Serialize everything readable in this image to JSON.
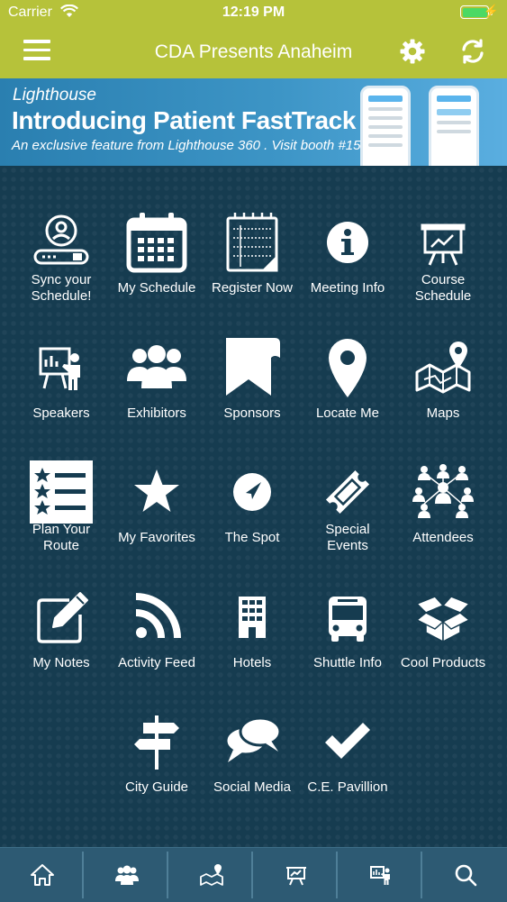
{
  "status_bar": {
    "carrier": "Carrier",
    "time": "12:19 PM",
    "battery_color": "#4cd964"
  },
  "navbar": {
    "title": "CDA Presents Anaheim",
    "background": "#b6c23a",
    "left_icon": "hamburger-menu-icon",
    "right_icons": [
      "gear-icon",
      "refresh-icon"
    ]
  },
  "banner": {
    "brand": "Lighthouse",
    "headline": "Introducing Patient FastTrack",
    "subtext": "An exclusive feature from Lighthouse 360 . Visit booth #1534"
  },
  "grid": {
    "tiles": [
      {
        "label": "Sync your\nSchedule!",
        "icon": "sync-schedule-icon"
      },
      {
        "label": "My Schedule",
        "icon": "calendar-icon"
      },
      {
        "label": "Register Now",
        "icon": "notepad-icon"
      },
      {
        "label": "Meeting Info",
        "icon": "info-icon"
      },
      {
        "label": "Course\nSchedule",
        "icon": "presentation-board-icon"
      },
      {
        "label": "Speakers",
        "icon": "speaker-icon"
      },
      {
        "label": "Exhibitors",
        "icon": "people-group-icon"
      },
      {
        "label": "Sponsors",
        "icon": "bookmark-ribbon-icon"
      },
      {
        "label": "Locate Me",
        "icon": "map-pin-icon"
      },
      {
        "label": "Maps",
        "icon": "folded-map-icon"
      },
      {
        "label": "Plan Your\nRoute",
        "icon": "star-list-icon"
      },
      {
        "label": "My Favorites",
        "icon": "star-icon"
      },
      {
        "label": "The Spot",
        "icon": "navigation-arrow-icon"
      },
      {
        "label": "Special\nEvents",
        "icon": "ticket-icon"
      },
      {
        "label": "Attendees",
        "icon": "network-people-icon"
      },
      {
        "label": "My Notes",
        "icon": "edit-note-icon"
      },
      {
        "label": "Activity Feed",
        "icon": "rss-icon"
      },
      {
        "label": "Hotels",
        "icon": "building-icon"
      },
      {
        "label": "Shuttle Info",
        "icon": "bus-icon"
      },
      {
        "label": "Cool Products",
        "icon": "open-box-icon"
      },
      {
        "label": "City Guide",
        "icon": "signpost-icon"
      },
      {
        "label": "Social Media",
        "icon": "chat-bubbles-icon"
      },
      {
        "label": "C.E. Pavillion",
        "icon": "checkmark-icon"
      }
    ]
  },
  "tab_bar": {
    "tabs": [
      "home-icon",
      "people-group-icon",
      "folded-map-icon",
      "presentation-board-icon",
      "speaker-icon",
      "search-icon"
    ]
  }
}
